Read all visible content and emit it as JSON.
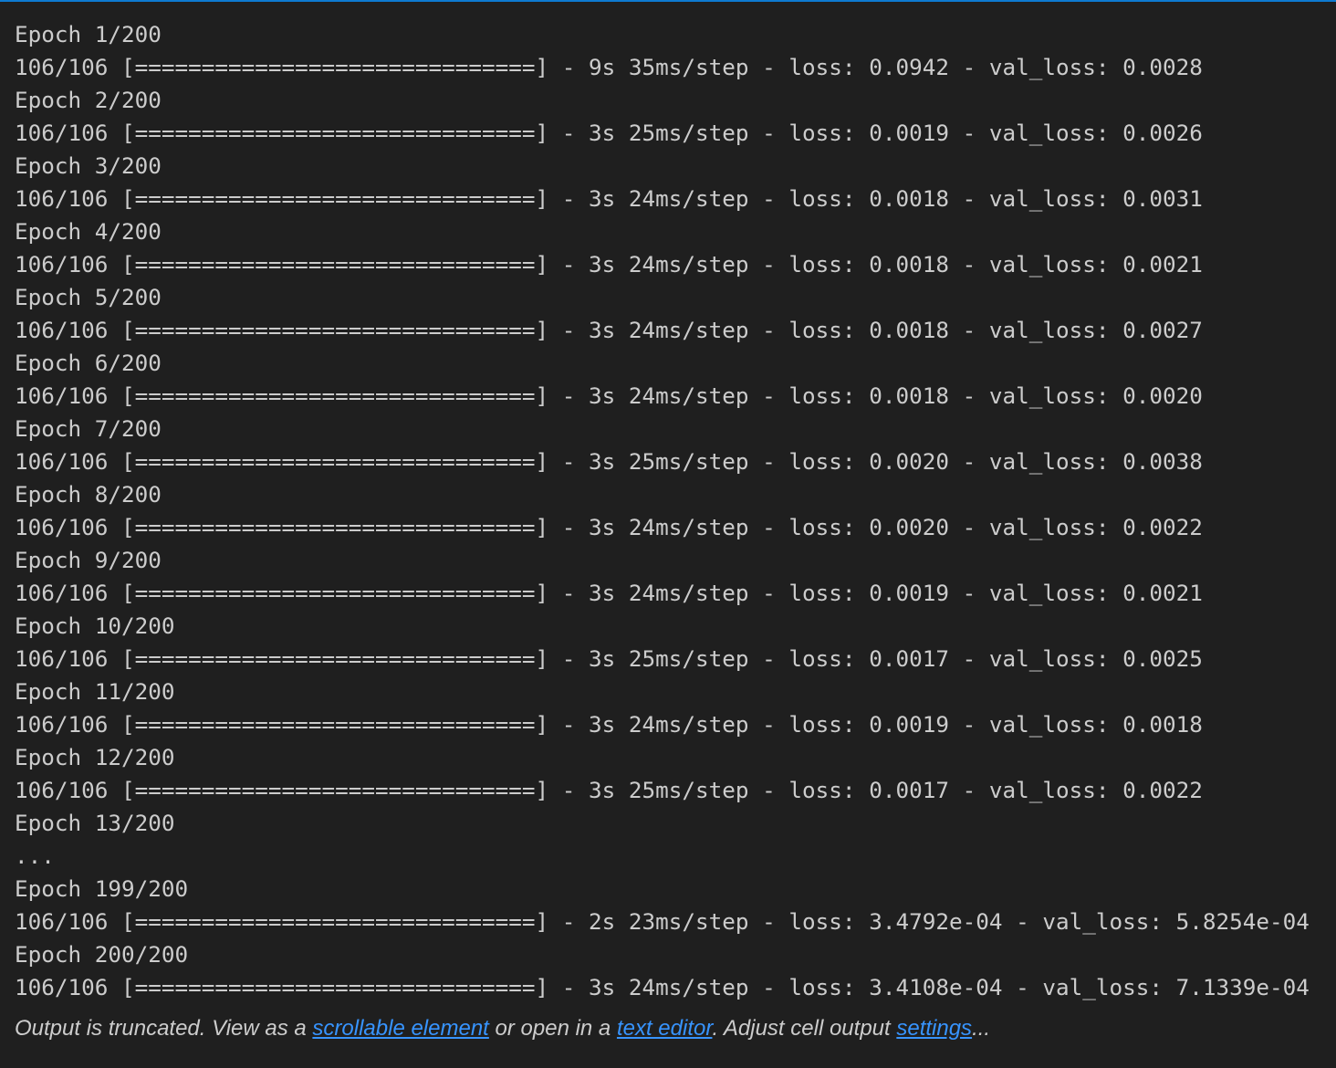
{
  "accent_color": "#0e7ad1",
  "link_color": "#3794ff",
  "output_lines": [
    "Epoch 1/200",
    "106/106 [==============================] - 9s 35ms/step - loss: 0.0942 - val_loss: 0.0028",
    "Epoch 2/200",
    "106/106 [==============================] - 3s 25ms/step - loss: 0.0019 - val_loss: 0.0026",
    "Epoch 3/200",
    "106/106 [==============================] - 3s 24ms/step - loss: 0.0018 - val_loss: 0.0031",
    "Epoch 4/200",
    "106/106 [==============================] - 3s 24ms/step - loss: 0.0018 - val_loss: 0.0021",
    "Epoch 5/200",
    "106/106 [==============================] - 3s 24ms/step - loss: 0.0018 - val_loss: 0.0027",
    "Epoch 6/200",
    "106/106 [==============================] - 3s 24ms/step - loss: 0.0018 - val_loss: 0.0020",
    "Epoch 7/200",
    "106/106 [==============================] - 3s 25ms/step - loss: 0.0020 - val_loss: 0.0038",
    "Epoch 8/200",
    "106/106 [==============================] - 3s 24ms/step - loss: 0.0020 - val_loss: 0.0022",
    "Epoch 9/200",
    "106/106 [==============================] - 3s 24ms/step - loss: 0.0019 - val_loss: 0.0021",
    "Epoch 10/200",
    "106/106 [==============================] - 3s 25ms/step - loss: 0.0017 - val_loss: 0.0025",
    "Epoch 11/200",
    "106/106 [==============================] - 3s 24ms/step - loss: 0.0019 - val_loss: 0.0018",
    "Epoch 12/200",
    "106/106 [==============================] - 3s 25ms/step - loss: 0.0017 - val_loss: 0.0022",
    "Epoch 13/200",
    "...",
    "Epoch 199/200",
    "106/106 [==============================] - 2s 23ms/step - loss: 3.4792e-04 - val_loss: 5.8254e-04",
    "Epoch 200/200",
    "106/106 [==============================] - 3s 24ms/step - loss: 3.4108e-04 - val_loss: 7.1339e-04"
  ],
  "footer": {
    "text1": "Output is truncated. View as a ",
    "link1": "scrollable element",
    "text2": " or open in a ",
    "link2": "text editor",
    "text3": ". Adjust cell output ",
    "link3": "settings",
    "text4": "..."
  }
}
